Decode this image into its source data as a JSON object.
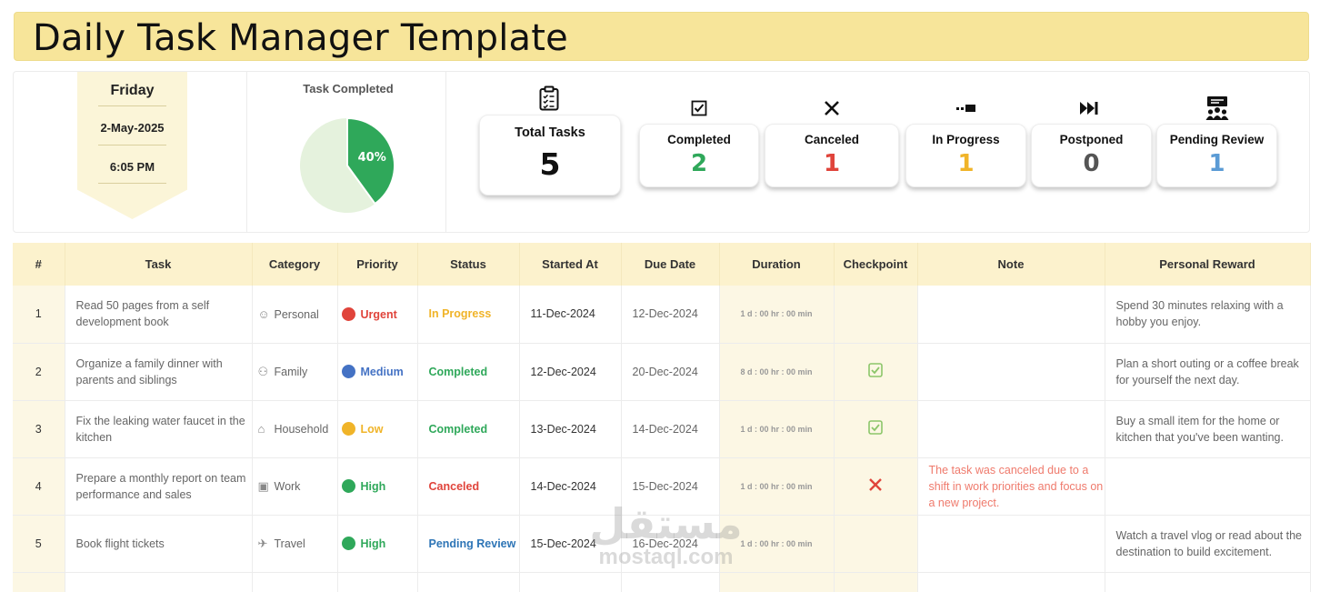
{
  "title": "Daily Task Manager Template",
  "date_panel": {
    "day": "Friday",
    "date": "2-May-2025",
    "time": "6:05 PM"
  },
  "pie": {
    "title": "Task Completed",
    "label": "40%",
    "completed_fraction": 0.4,
    "completed_color": "#2fa85a",
    "remaining_color": "#e5f2dd"
  },
  "total": {
    "label": "Total Tasks",
    "value": "5",
    "icon": "clipboard-icon"
  },
  "stats": [
    {
      "label": "Completed",
      "value": "2",
      "color": "#2fa85a",
      "icon": "checkbox-icon"
    },
    {
      "label": "Canceled",
      "value": "1",
      "color": "#e0443b",
      "icon": "close-icon"
    },
    {
      "label": "In Progress",
      "value": "1",
      "color": "#f0b429",
      "icon": "progress-icon"
    },
    {
      "label": "Postponed",
      "value": "0",
      "color": "#555555",
      "icon": "skip-forward-icon"
    },
    {
      "label": "Pending Review",
      "value": "1",
      "color": "#5b9bd5",
      "icon": "presentation-icon"
    }
  ],
  "table": {
    "headers": [
      "#",
      "Task",
      "Category",
      "Priority",
      "Status",
      "Started At",
      "Due Date",
      "Duration",
      "Checkpoint",
      "Note",
      "Personal Reward"
    ],
    "rows": [
      {
        "num": "1",
        "task": "Read 50 pages from a self development book",
        "category": "Personal",
        "category_icon": "person-icon",
        "priority": "Urgent",
        "priority_color": "#e0443b",
        "status": "In Progress",
        "status_color": "#f0b429",
        "started": "11-Dec-2024",
        "due": "12-Dec-2024",
        "duration": "1 d : 00 hr : 00 min",
        "checkpoint": "",
        "note": "",
        "reward": "Spend 30 minutes relaxing with a hobby you enjoy."
      },
      {
        "num": "2",
        "task": "Organize a family dinner with parents and siblings",
        "category": "Family",
        "category_icon": "family-icon",
        "priority": "Medium",
        "priority_color": "#4472c4",
        "status": "Completed",
        "status_color": "#2fa85a",
        "started": "12-Dec-2024",
        "due": "20-Dec-2024",
        "duration": "8 d : 00 hr : 00 min",
        "checkpoint": "done",
        "note": "",
        "reward": "Plan a short outing or a coffee break for yourself the next day."
      },
      {
        "num": "3",
        "task": "Fix the leaking water faucet in the kitchen",
        "category": "Household",
        "category_icon": "house-icon",
        "priority": "Low",
        "priority_color": "#f0b429",
        "status": "Completed",
        "status_color": "#2fa85a",
        "started": "13-Dec-2024",
        "due": "14-Dec-2024",
        "duration": "1 d : 00 hr : 00 min",
        "checkpoint": "done",
        "note": "",
        "reward": "Buy a small item for the home or kitchen that you've been wanting."
      },
      {
        "num": "4",
        "task": "Prepare a monthly report on team performance and sales",
        "category": "Work",
        "category_icon": "computer-icon",
        "priority": "High",
        "priority_color": "#2fa85a",
        "status": "Canceled",
        "status_color": "#e0443b",
        "started": "14-Dec-2024",
        "due": "15-Dec-2024",
        "duration": "1 d : 00 hr : 00 min",
        "checkpoint": "canceled",
        "note": "The task was canceled due to a shift in work priorities and focus on a new project.",
        "reward": ""
      },
      {
        "num": "5",
        "task": "Book flight tickets",
        "category": "Travel",
        "category_icon": "airplane-icon",
        "priority": "High",
        "priority_color": "#2fa85a",
        "status": "Pending Review",
        "status_color": "#2e75b6",
        "started": "15-Dec-2024",
        "due": "16-Dec-2024",
        "duration": "1 d : 00 hr : 00 min",
        "checkpoint": "",
        "note": "",
        "reward": "Watch a travel vlog or read about the destination to build excitement."
      }
    ]
  },
  "watermark": {
    "arabic": "مستقل",
    "latin": "mostaql.com"
  }
}
